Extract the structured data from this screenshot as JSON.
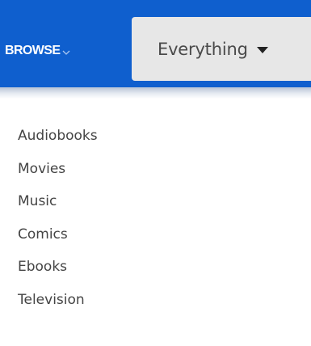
{
  "header": {
    "browse_label": "BROWSE",
    "browse_icon": "chevron-down-icon",
    "scope_label": "Everything",
    "scope_icon": "caret-down-icon",
    "bar_color": "#0f5fce"
  },
  "menu": {
    "items": [
      {
        "label": "Audiobooks"
      },
      {
        "label": "Movies"
      },
      {
        "label": "Music"
      },
      {
        "label": "Comics"
      },
      {
        "label": "Ebooks"
      },
      {
        "label": "Television"
      }
    ]
  }
}
